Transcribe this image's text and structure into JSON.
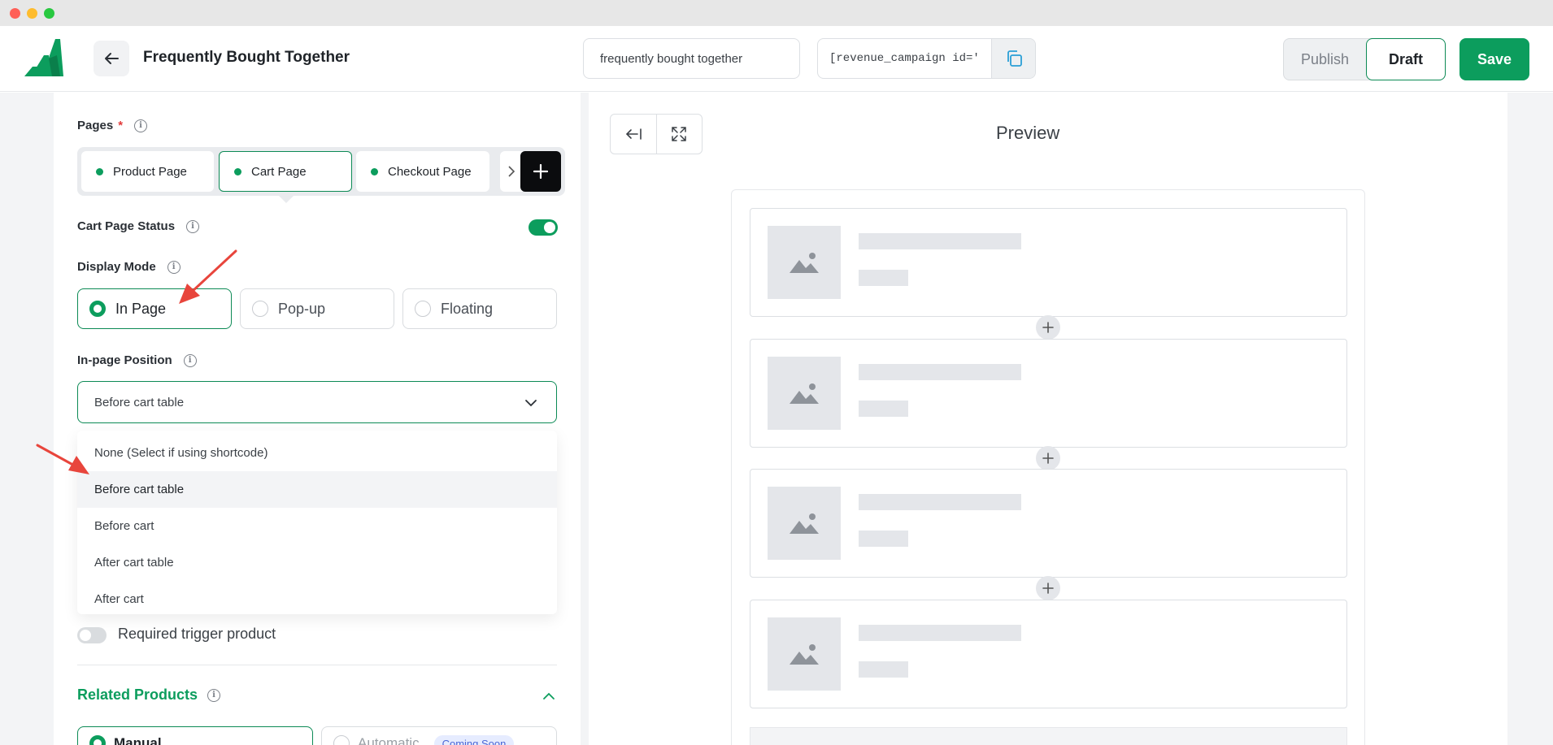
{
  "header": {
    "title": "Frequently Bought Together",
    "campaign_name": "frequently bought together",
    "shortcode": "[revenue_campaign id='",
    "publish_label": "Publish",
    "draft_label": "Draft",
    "save_label": "Save"
  },
  "pages": {
    "label": "Pages",
    "required_mark": "*",
    "tabs": [
      {
        "label": "Product Page"
      },
      {
        "label": "Cart Page"
      },
      {
        "label": "Checkout Page"
      }
    ]
  },
  "status": {
    "label": "Cart Page Status",
    "enabled": true
  },
  "display_mode": {
    "label": "Display Mode",
    "options": [
      {
        "label": "In Page"
      },
      {
        "label": "Pop-up"
      },
      {
        "label": "Floating"
      }
    ],
    "selected": "In Page"
  },
  "position": {
    "label": "In-page Position",
    "selected": "Before cart table",
    "options": [
      "None (Select if using shortcode)",
      "Before cart table",
      "Before cart",
      "After cart table",
      "After cart"
    ]
  },
  "trigger": {
    "label": "Required trigger product",
    "enabled": false
  },
  "related": {
    "title": "Related Products",
    "manual_label": "Manual",
    "auto_label": "Automatic",
    "badge": "Coming Soon"
  },
  "preview": {
    "title": "Preview"
  },
  "colors": {
    "brand_green": "#0c9d5d",
    "annotation_red": "#e8453c"
  },
  "icons": [
    "logo-icon",
    "back-arrow-icon",
    "copy-icon",
    "chevron-right-icon",
    "plus-icon",
    "info-icon",
    "chevron-down-icon",
    "chevron-up-icon",
    "collapse-left-icon",
    "expand-icon",
    "image-placeholder-icon"
  ]
}
